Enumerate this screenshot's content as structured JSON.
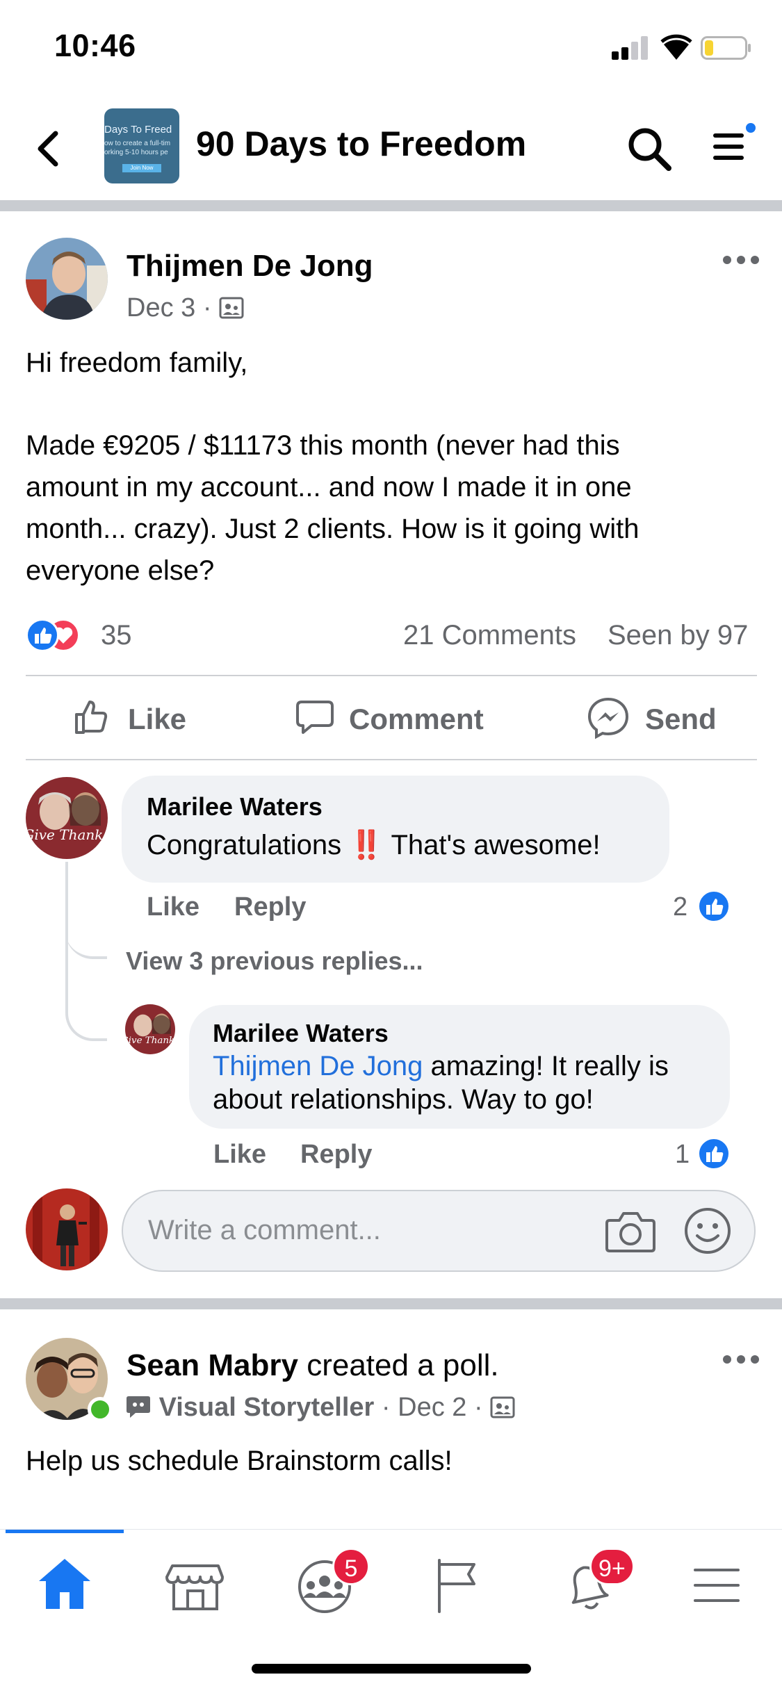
{
  "status_bar": {
    "time": "10:46"
  },
  "header": {
    "group_title": "90 Days to Freedom",
    "thumb_line1": "Days To Freed",
    "thumb_line2": "ow to create a full-tim",
    "thumb_line3": "orking 5-10 hours pe",
    "thumb_button": "Join Now"
  },
  "post": {
    "author": "Thijmen De Jong",
    "date": "Dec 3",
    "meta_sep": "·",
    "greeting": "Hi freedom family,",
    "body_line1": "Made €9205 / $11173 this month (never had this",
    "body_line2": "amount in my account... and now I made it in one",
    "body_line3": "month... crazy). Just 2 clients. How is it going with",
    "body_line4": "everyone else?",
    "reaction_count": "35",
    "comments_count": "21 Comments",
    "seen_by": "Seen by 97",
    "actions": {
      "like": "Like",
      "comment": "Comment",
      "send": "Send"
    }
  },
  "comments": [
    {
      "name": "Marilee Waters",
      "text_before": "Congratulations ",
      "emoji": "‼️",
      "text_after": " That's awesome!",
      "like": "Like",
      "reply": "Reply",
      "likes": "2"
    }
  ],
  "view_previous": "View 3 previous replies...",
  "reply": {
    "name": "Marilee Waters",
    "mention": "Thijmen De Jong",
    "text_line1": " amazing! It really is",
    "text_line2": "about relationships. Way to go!",
    "like": "Like",
    "reply": "Reply",
    "likes": "1"
  },
  "composer": {
    "placeholder": "Write a comment..."
  },
  "next_post": {
    "author": "Sean Mabry",
    "action": " created a poll.",
    "group": "Visual Storyteller",
    "date": "Dec 2",
    "meta_sep": "·",
    "text": "Help us schedule Brainstorm calls!"
  },
  "bottom_nav": {
    "groups_badge": "5",
    "notifications_badge": "9+"
  },
  "colors": {
    "facebook_blue": "#1877f2",
    "badge_red": "#e41e3f",
    "secondary_text": "#65676b"
  }
}
